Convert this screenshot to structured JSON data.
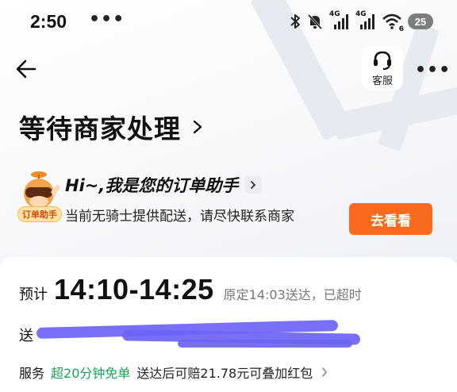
{
  "status_bar": {
    "time": "2:50",
    "dots": "•••",
    "network_1": "4G",
    "network_2": "4G",
    "wifi_badge": "6",
    "battery": "25"
  },
  "header": {
    "service_label": "客服",
    "more": "•••"
  },
  "order": {
    "title": "等待商家处理"
  },
  "assistant": {
    "mascot_tag": "订单助手",
    "greeting": "Hi~,我是您的订单助手",
    "message": "当前无骑士提供配送，请尽快联系商家",
    "button_label": "去看看"
  },
  "delivery": {
    "eta_prefix": "预计",
    "eta_time": "14:10-14:25",
    "eta_note": "原定14:03送达，已超时",
    "address_label": "送",
    "service_label": "服务",
    "service_highlight": "超20分钟免单",
    "service_text": "送达后可赔21.78元可叠加红包"
  },
  "colors": {
    "accent_orange": "#fa6a1e",
    "service_green": "#1aa55a",
    "redaction": "#6b63f5"
  }
}
